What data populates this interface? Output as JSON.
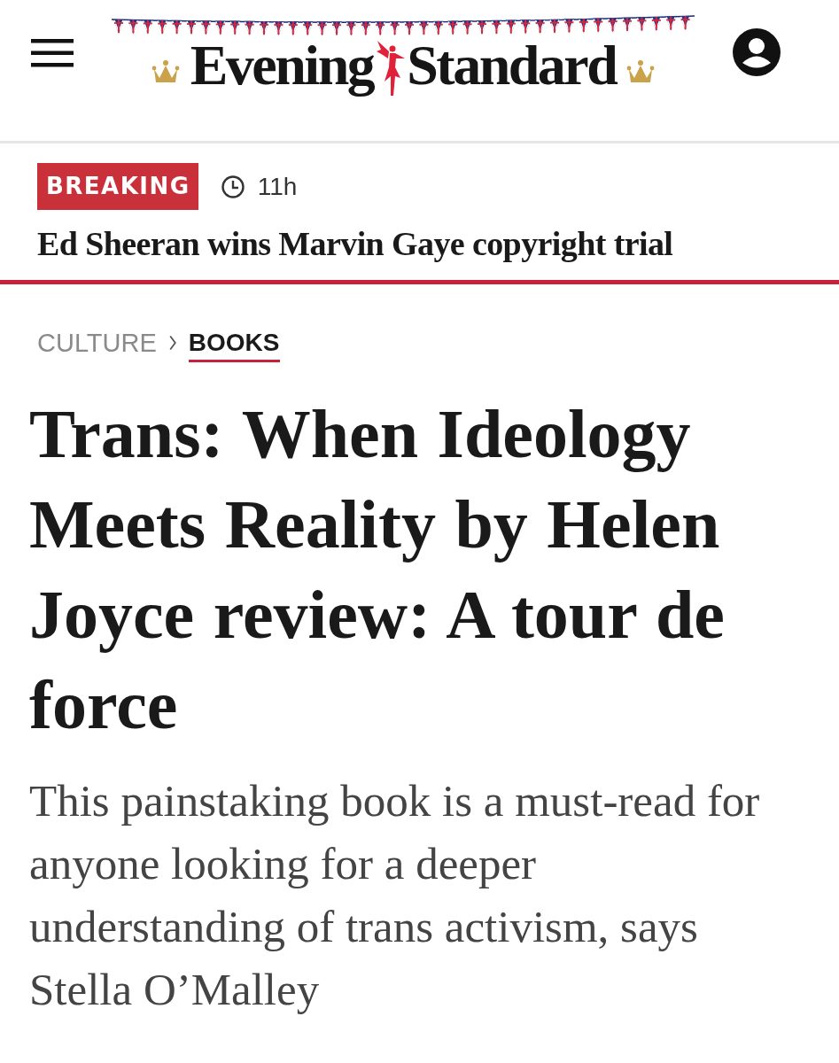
{
  "header": {
    "logo": {
      "word_1": "Evening",
      "word_2": "Standard"
    }
  },
  "breaking": {
    "label": "BREAKING",
    "time": "11h",
    "headline": "Ed Sheeran wins Marvin Gaye copyright trial"
  },
  "breadcrumbs": [
    {
      "label": "CULTURE",
      "selected": false
    },
    {
      "label": "BOOKS",
      "selected": true
    }
  ],
  "article": {
    "headline": "Trans: When Ideology Meets Reality by Helen Joyce review: A tour de force",
    "standfirst": "This painstaking book is a must-read for anyone looking for a deeper understanding of trans activism, says Stella O’Malley"
  }
}
